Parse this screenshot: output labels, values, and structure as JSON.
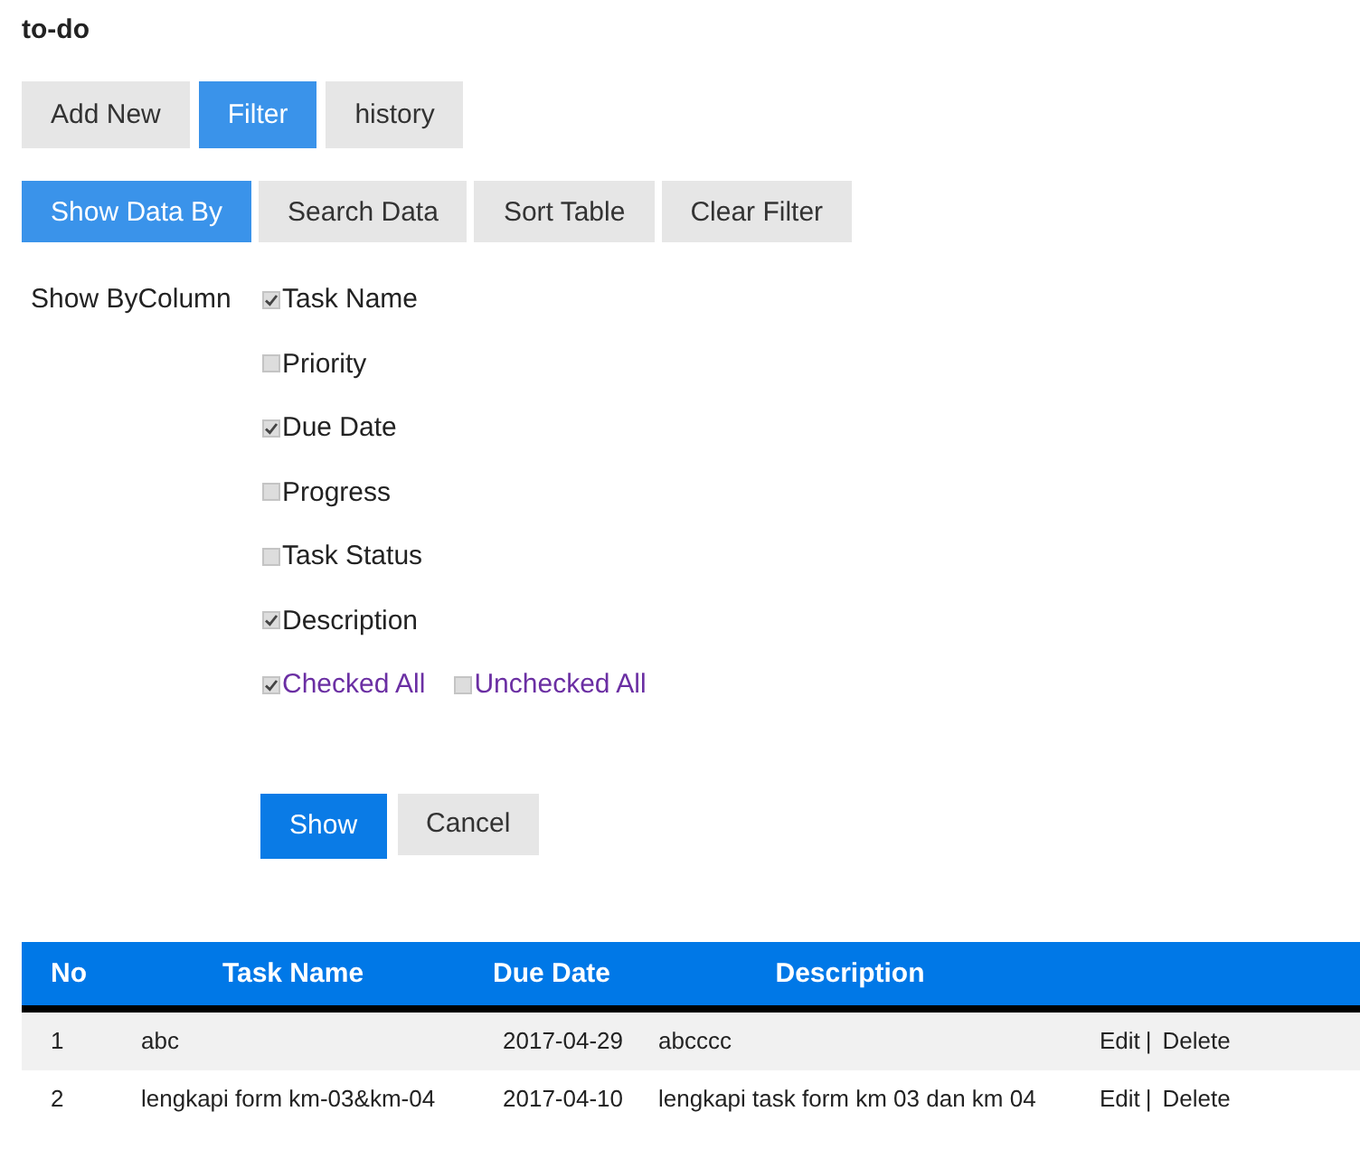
{
  "title": "to-do",
  "tabs": [
    {
      "label": "Add New",
      "selected": false
    },
    {
      "label": "Filter",
      "selected": true
    },
    {
      "label": "history",
      "selected": false
    }
  ],
  "filter_tabs": [
    {
      "label": "Show Data By",
      "selected": true
    },
    {
      "label": "Search Data",
      "selected": false
    },
    {
      "label": "Sort Table",
      "selected": false
    },
    {
      "label": "Clear Filter",
      "selected": false
    }
  ],
  "show_by": {
    "label": "Show ByColumn",
    "columns": [
      {
        "label": "Task Name",
        "checked": true
      },
      {
        "label": "Priority",
        "checked": false
      },
      {
        "label": "Due Date",
        "checked": true
      },
      {
        "label": "Progress",
        "checked": false
      },
      {
        "label": "Task Status",
        "checked": false
      },
      {
        "label": "Description",
        "checked": true
      }
    ],
    "bulk": [
      {
        "label": "Checked All",
        "checked": true
      },
      {
        "label": "Unchecked All",
        "checked": false
      }
    ]
  },
  "buttons": [
    {
      "label": "Show",
      "kind": "primary"
    },
    {
      "label": "Cancel",
      "kind": "secondary"
    }
  ],
  "table": {
    "columns": [
      "No",
      "Task Name",
      "Due Date",
      "Description"
    ],
    "rows": [
      {
        "cells": [
          "1",
          "abc",
          "2017-04-29",
          "abcccc"
        ],
        "edit": "Edit",
        "separator": "|",
        "delete": "Delete"
      },
      {
        "cells": [
          "2",
          "lengkapi form km-03&km-04",
          "2017-04-10",
          "lengkapi task form km 03 dan km 04"
        ],
        "edit": "Edit",
        "separator": "|",
        "delete": "Delete"
      }
    ]
  }
}
